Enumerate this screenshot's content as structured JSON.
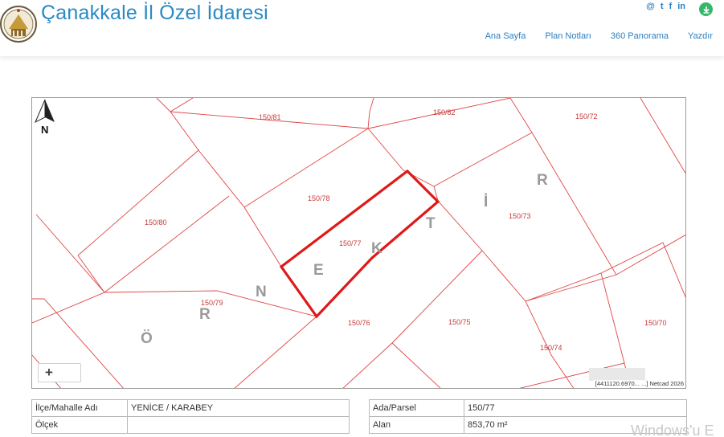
{
  "header": {
    "title": "Çanakkale İl Özel İdaresi",
    "social": [
      "@",
      "t",
      "f",
      "in"
    ],
    "nav": [
      "Ana Sayfa",
      "Plan Notları",
      "360 Panorama",
      "Yazdır"
    ]
  },
  "map": {
    "parcels": [
      "150/81",
      "150/82",
      "150/72",
      "150/78",
      "150/80",
      "150/77",
      "150/73",
      "150/79",
      "150/76",
      "150/75",
      "150/70",
      "150/74"
    ],
    "watermark_letters": [
      "Ö",
      "R",
      "N",
      "E",
      "K",
      "T",
      "İ",
      "R"
    ],
    "zoom_label": "+",
    "coordinates": "[4411120.6970... ...] Netcad 2026",
    "north_label": "N"
  },
  "info": {
    "left": [
      {
        "label": "İlçe/Mahalle Adı",
        "value": "YENİCE / KARABEY"
      },
      {
        "label": "Ölçek",
        "value": ""
      }
    ],
    "right": [
      {
        "label": "Ada/Parsel",
        "value": "150/77"
      },
      {
        "label": "Alan",
        "value": "853,70 m²"
      }
    ]
  },
  "os_watermark": "Windows'u E"
}
